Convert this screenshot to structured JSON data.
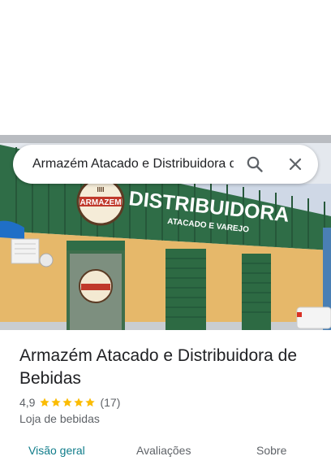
{
  "search": {
    "query": "Armazém Atacado e Distribuidora de Bebidas"
  },
  "photo": {
    "sign_main": "DISTRIBUIDORA",
    "sign_sub": "ATACADO E VAREJO",
    "logo_text": "ARMAZEM",
    "logo_top": "IIII"
  },
  "place": {
    "title": "Armazém Atacado e Distribuidora de Bebidas",
    "rating": "4,9",
    "stars": 5,
    "review_count": "(17)",
    "category": "Loja de bebidas"
  },
  "tabs": [
    {
      "label": "Visão geral",
      "active": true
    },
    {
      "label": "Avaliações",
      "active": false
    },
    {
      "label": "Sobre",
      "active": false
    }
  ],
  "colors": {
    "star": "#fbbc04",
    "active_tab": "#0f7c8a",
    "facade_green": "#2e6b45",
    "wall": "#e6b86a"
  }
}
